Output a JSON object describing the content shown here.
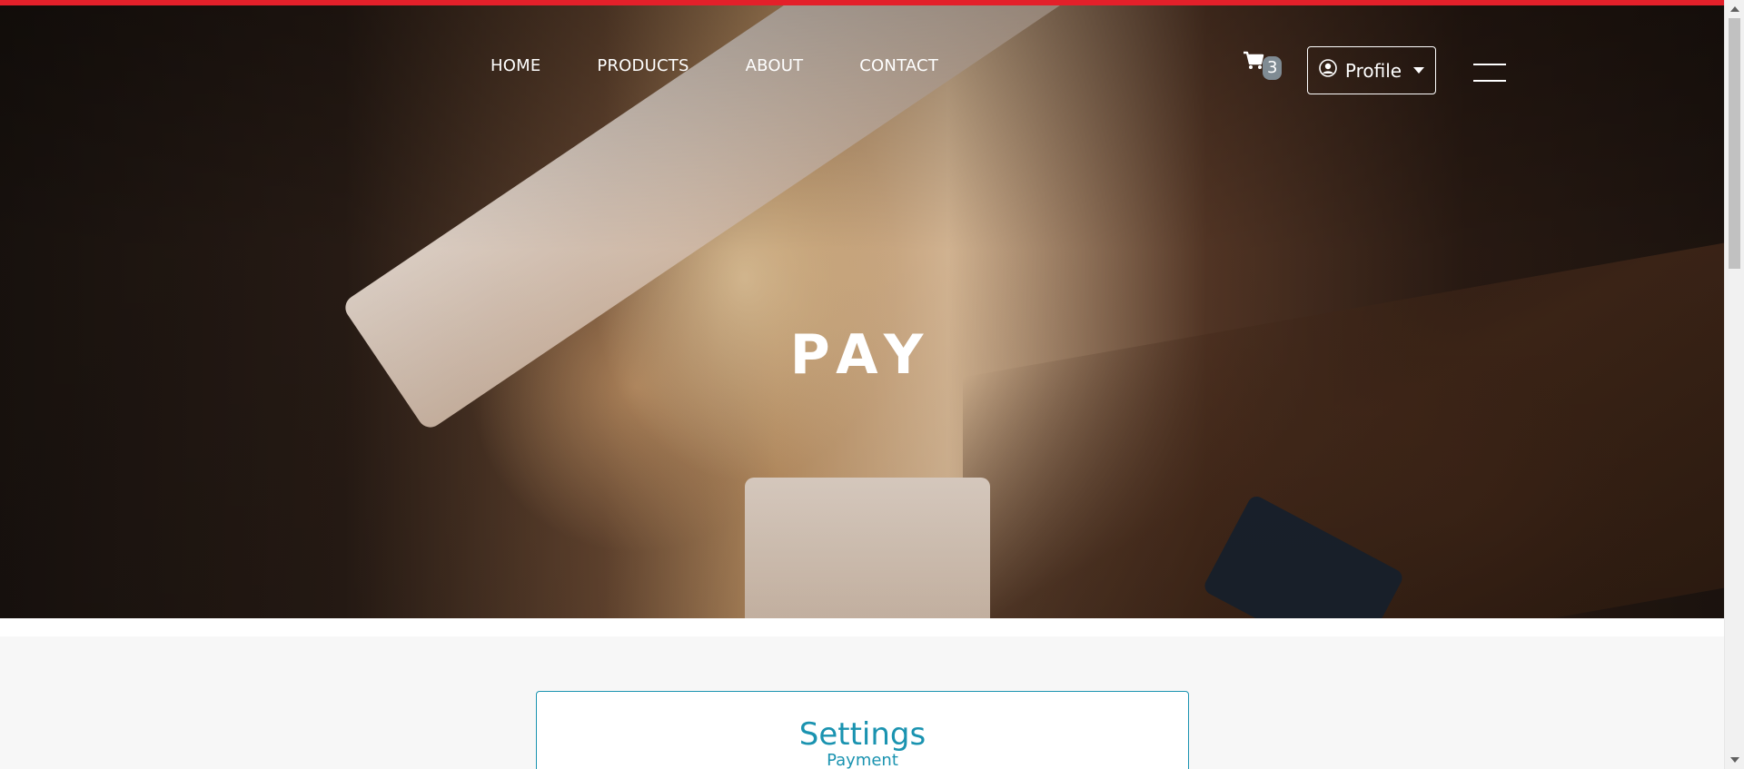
{
  "nav": {
    "links": [
      "HOME",
      "PRODUCTS",
      "ABOUT",
      "CONTACT"
    ],
    "cart_count": "3",
    "profile_label": "Profile"
  },
  "hero": {
    "title": "PAY"
  },
  "settings": {
    "title": "Settings",
    "subtitle": "Payment"
  },
  "colors": {
    "top_strip": "#e3202a",
    "accent": "#1a93b0",
    "badge": "#7f8b93"
  },
  "icons": {
    "cart": "cart-icon",
    "profile": "user-circle-icon",
    "menu": "hamburger-menu-icon"
  },
  "scrollbar": {
    "position_fraction": 0.0
  }
}
